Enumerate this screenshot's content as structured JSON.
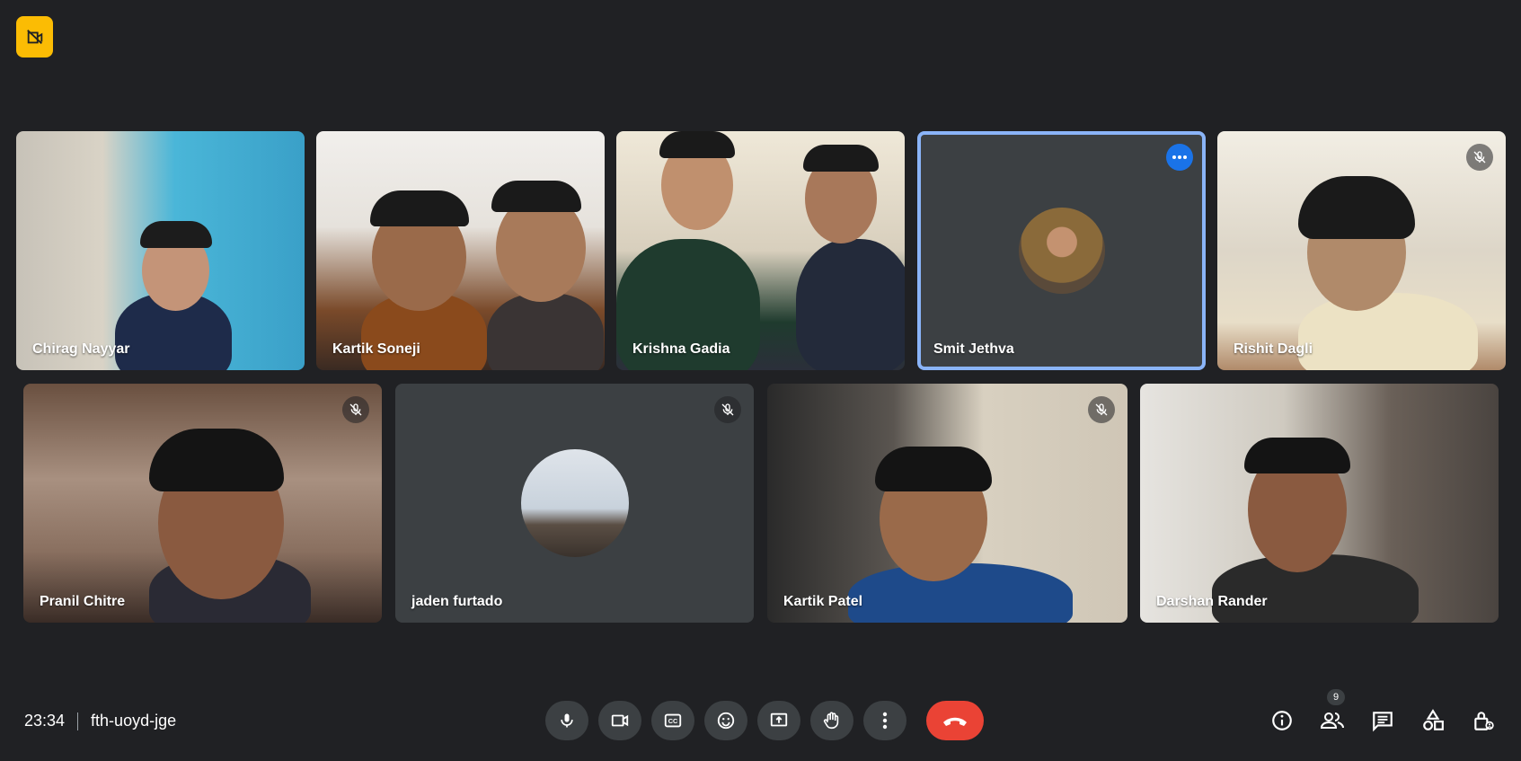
{
  "recording_icon": "no-video-recording-icon",
  "participants": [
    {
      "name": "Chirag Nayyar"
    },
    {
      "name": "Kartik Soneji"
    },
    {
      "name": "Krishna Gadia"
    },
    {
      "name": "Smit Jethva"
    },
    {
      "name": "Rishit Dagli"
    },
    {
      "name": "Pranil Chitre"
    },
    {
      "name": "jaden furtado"
    },
    {
      "name": "Kartik Patel"
    },
    {
      "name": "Darshan Rander"
    }
  ],
  "meeting": {
    "time": "23:34",
    "code": "fth-uoyd-jge"
  },
  "controls": [
    {
      "icon": "microphone-icon"
    },
    {
      "icon": "camera-icon"
    },
    {
      "icon": "captions-icon"
    },
    {
      "icon": "emoji-icon"
    },
    {
      "icon": "present-screen-icon"
    },
    {
      "icon": "raise-hand-icon"
    },
    {
      "icon": "more-options-icon"
    },
    {
      "icon": "end-call-icon"
    }
  ],
  "right_panel": {
    "people_count": "9",
    "icons": [
      "info-icon",
      "people-icon",
      "chat-icon",
      "activities-icon",
      "host-controls-icon"
    ]
  },
  "colors": {
    "background": "#202124",
    "tile": "#3c4043",
    "active_border": "#8ab4f8",
    "end_call": "#ea4335",
    "recording": "#fbbc04"
  }
}
